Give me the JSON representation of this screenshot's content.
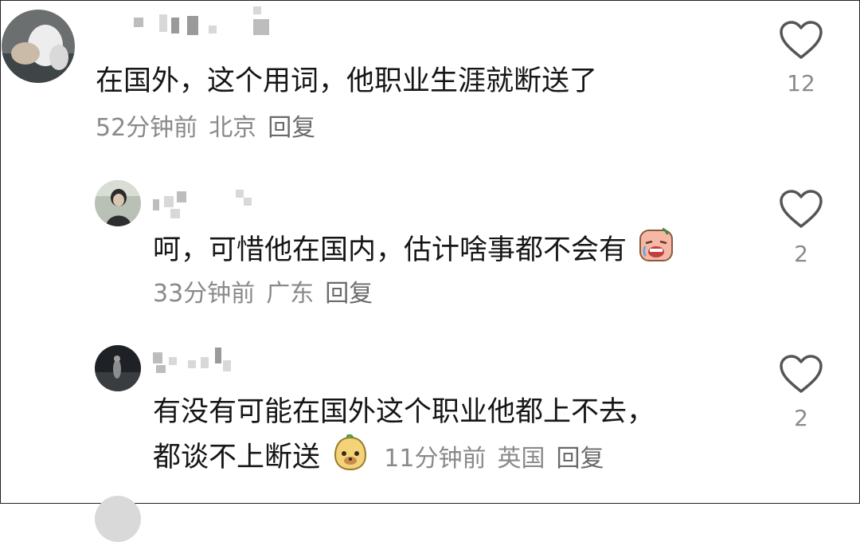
{
  "comments": [
    {
      "text": "在国外，这个用词，他职业生涯就断送了",
      "time": "52分钟前",
      "location": "北京",
      "reply_label": "回复",
      "likes": "12",
      "avatar": "avatar-photo"
    },
    {
      "text": "呵，可惜他在国内，估计啥事都不会有",
      "time": "33分钟前",
      "location": "广东",
      "reply_label": "回复",
      "likes": "2",
      "avatar": "avatar-photo",
      "emoji": "crying-face-emoji"
    },
    {
      "text_line1": "有没有可能在国外这个职业他都上不去，",
      "text_line2": "都谈不上断送",
      "time": "11分钟前",
      "location": "英国",
      "reply_label": "回复",
      "likes": "2",
      "avatar": "avatar-photo",
      "emoji": "dog-face-emoji"
    }
  ],
  "colors": {
    "text": "#161616",
    "meta": "#8a8a8a",
    "heart": "#555555"
  },
  "icons": {
    "like": "heart-outline-icon"
  }
}
